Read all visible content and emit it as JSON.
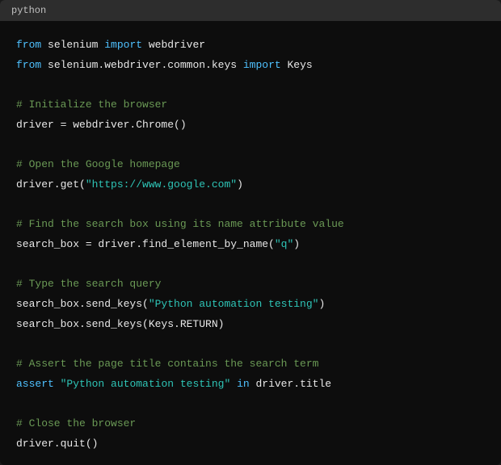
{
  "header": {
    "language": "python"
  },
  "code": {
    "l1": {
      "kw1": "from",
      "mod1": " selenium ",
      "kw2": "import",
      "mod2": " webdriver"
    },
    "l2": {
      "kw1": "from",
      "mod1": " selenium.webdriver.common.keys ",
      "kw2": "import",
      "mod2": " Keys"
    },
    "c1": "# Initialize the browser",
    "l3": "driver = webdriver.Chrome()",
    "c2": "# Open the Google homepage",
    "l4": {
      "pre": "driver.get(",
      "str": "\"https://www.google.com\"",
      "post": ")"
    },
    "c3": "# Find the search box using its name attribute value",
    "l5": {
      "pre": "search_box = driver.find_element_by_name(",
      "str": "\"q\"",
      "post": ")"
    },
    "c4": "# Type the search query",
    "l6": {
      "pre": "search_box.send_keys(",
      "str": "\"Python automation testing\"",
      "post": ")"
    },
    "l7": "search_box.send_keys(Keys.RETURN)",
    "c5": "# Assert the page title contains the search term",
    "l8": {
      "kw": "assert",
      "sp": " ",
      "str": "\"Python automation testing\"",
      "in": " in",
      "post": " driver.title"
    },
    "c6": "# Close the browser",
    "l9": "driver.quit()"
  }
}
